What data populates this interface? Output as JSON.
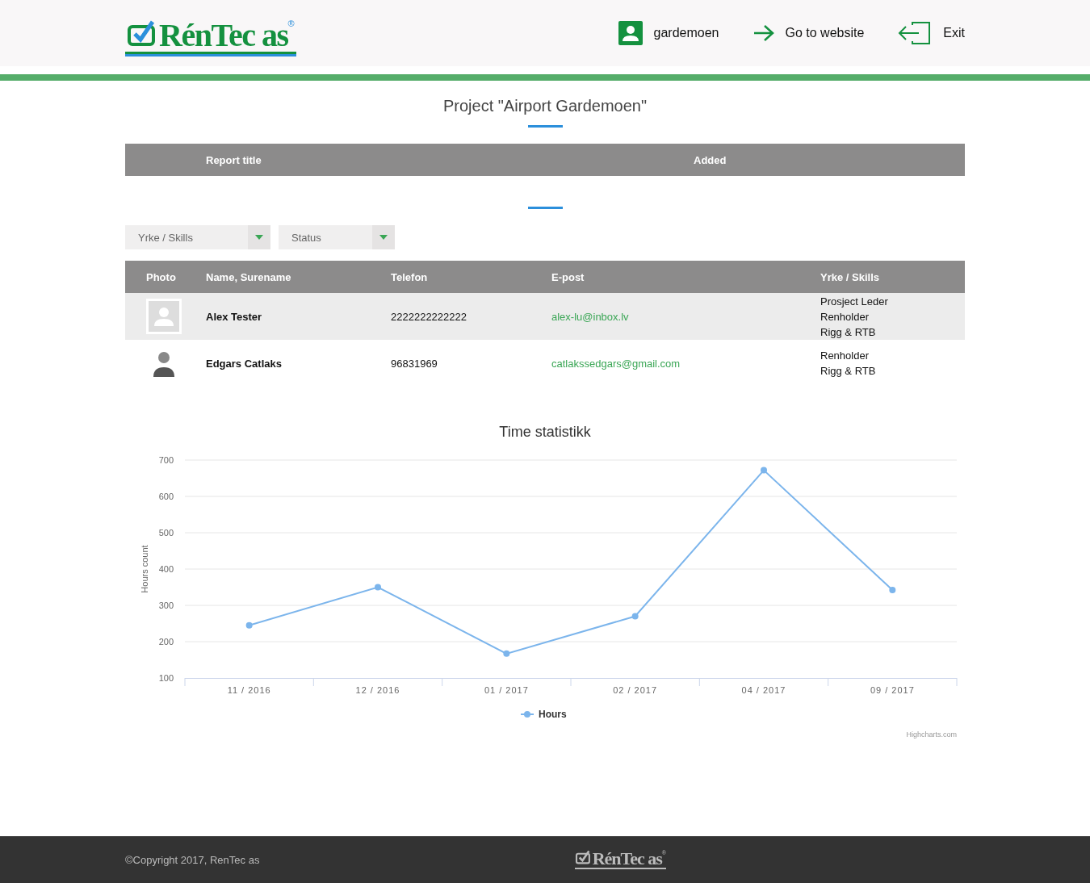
{
  "header": {
    "logo": {
      "text": "RénTec as",
      "mark": "®"
    },
    "nav": [
      {
        "kind": "user",
        "label": "gardemoen"
      },
      {
        "kind": "website",
        "label": "Go to website"
      },
      {
        "kind": "exit",
        "label": "Exit"
      }
    ]
  },
  "project_title": "Project \"Airport Gardemoen\"",
  "reports_table": {
    "columns": [
      "Report title",
      "Added"
    ]
  },
  "filters": [
    {
      "placeholder": "Yrke / Skills"
    },
    {
      "placeholder": "Status"
    }
  ],
  "workers_table": {
    "columns": [
      "Photo",
      "Name, Surename",
      "Telefon",
      "E-post",
      "Yrke / Skills"
    ],
    "rows": [
      {
        "kind": "placeholder",
        "name": "Alex Tester",
        "phone": "2222222222222",
        "email": "alex-lu@inbox.lv",
        "skills": [
          "Prosject Leder",
          "Renholder",
          "Rigg & RTB"
        ]
      },
      {
        "kind": "photo",
        "name": "Edgars Catlaks",
        "phone": "96831969",
        "email": "catlakssedgars@gmail.com",
        "skills": [
          "Renholder",
          "Rigg & RTB"
        ]
      }
    ]
  },
  "chart": {
    "credit": "Highcharts.com",
    "chart_data": {
      "type": "line",
      "title": "Time statistikk",
      "ylabel": "Hours count",
      "categories": [
        "11 / 2016",
        "12 / 2016",
        "01 / 2017",
        "02 / 2017",
        "04 / 2017",
        "09 / 2017"
      ],
      "series": [
        {
          "name": "Hours",
          "color": "#7cb5ec",
          "values": [
            245,
            350,
            167,
            270,
            672,
            342
          ]
        }
      ],
      "ylim": [
        100,
        700
      ],
      "yticks": [
        100,
        200,
        300,
        400,
        500,
        600,
        700
      ],
      "grid": true,
      "marker": true
    }
  },
  "footer": {
    "copyright": "©Copyright 2017, RenTec as",
    "logo": {
      "text": "RénTec as",
      "mark": "®"
    }
  }
}
